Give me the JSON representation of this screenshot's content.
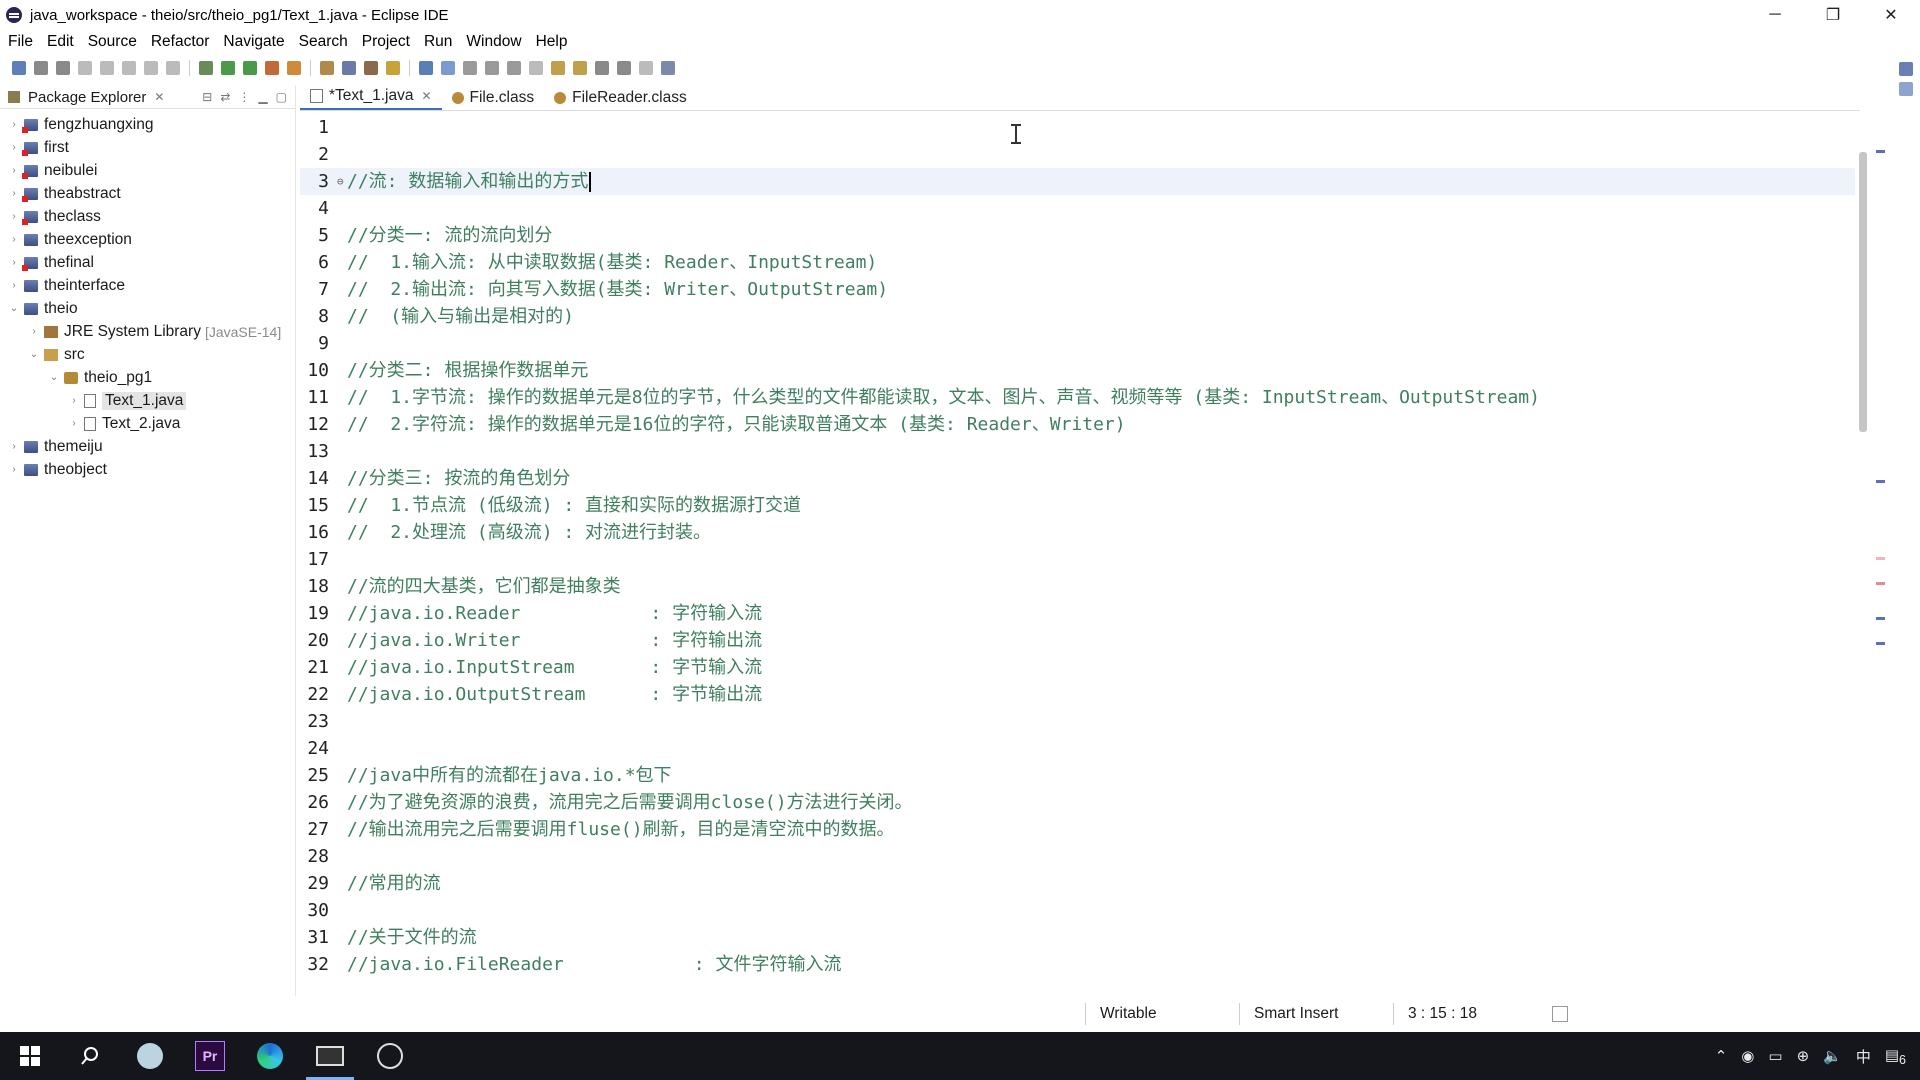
{
  "window": {
    "title": "java_workspace - theio/src/theio_pg1/Text_1.java - Eclipse IDE",
    "min": "─",
    "max": "❐",
    "close": "✕"
  },
  "menu": [
    "File",
    "Edit",
    "Source",
    "Refactor",
    "Navigate",
    "Search",
    "Project",
    "Run",
    "Window",
    "Help"
  ],
  "explorer": {
    "title": "Package Explorer",
    "close": "✕",
    "items": [
      {
        "label": "fengzhuangxing",
        "type": "project",
        "arrow": "›",
        "indent": 0
      },
      {
        "label": "first",
        "type": "project",
        "arrow": "›",
        "indent": 0
      },
      {
        "label": "neibulei",
        "type": "project",
        "arrow": "›",
        "indent": 0
      },
      {
        "label": "theabstract",
        "type": "project",
        "arrow": "›",
        "indent": 0
      },
      {
        "label": "theclass",
        "type": "project",
        "arrow": "›",
        "indent": 0
      },
      {
        "label": "theexception",
        "type": "project",
        "arrow": "›",
        "indent": 0
      },
      {
        "label": "thefinal",
        "type": "project",
        "arrow": "›",
        "indent": 0
      },
      {
        "label": "theinterface",
        "type": "project",
        "arrow": "›",
        "indent": 0
      },
      {
        "label": "theio",
        "type": "project",
        "arrow": "⌄",
        "indent": 0
      },
      {
        "label": "JRE System Library",
        "badge": "[JavaSE-14]",
        "type": "lib",
        "arrow": "›",
        "indent": 1
      },
      {
        "label": "src",
        "type": "src",
        "arrow": "⌄",
        "indent": 1
      },
      {
        "label": "theio_pg1",
        "type": "pkg",
        "arrow": "⌄",
        "indent": 2
      },
      {
        "label": "Text_1.java",
        "type": "java",
        "arrow": "›",
        "indent": 3,
        "selected": true
      },
      {
        "label": "Text_2.java",
        "type": "java",
        "arrow": "›",
        "indent": 3
      },
      {
        "label": "themeiju",
        "type": "project",
        "arrow": "›",
        "indent": 0
      },
      {
        "label": "theobject",
        "type": "project",
        "arrow": "›",
        "indent": 0
      }
    ]
  },
  "editor": {
    "tabs": [
      {
        "label": "*Text_1.java",
        "active": true,
        "closable": true,
        "kind": "java"
      },
      {
        "label": "File.class",
        "active": false,
        "closable": false,
        "kind": "class"
      },
      {
        "label": "FileReader.class",
        "active": false,
        "closable": false,
        "kind": "class"
      }
    ],
    "current_line": 3,
    "lines": [
      {
        "n": "1",
        "text": ""
      },
      {
        "n": "2",
        "text": ""
      },
      {
        "n": "3",
        "text": "//流: 数据输入和输出的方式",
        "fold": "⊖"
      },
      {
        "n": "4",
        "text": ""
      },
      {
        "n": "5",
        "text": "//分类一: 流的流向划分"
      },
      {
        "n": "6",
        "text": "//  1.输入流: 从中读取数据(基类: Reader、InputStream)"
      },
      {
        "n": "7",
        "text": "//  2.输出流: 向其写入数据(基类: Writer、OutputStream)"
      },
      {
        "n": "8",
        "text": "//  (输入与输出是相对的)"
      },
      {
        "n": "9",
        "text": ""
      },
      {
        "n": "10",
        "text": "//分类二: 根据操作数据单元"
      },
      {
        "n": "11",
        "text": "//  1.字节流: 操作的数据单元是8位的字节，什么类型的文件都能读取，文本、图片、声音、视频等等 (基类: InputStream、OutputStream)"
      },
      {
        "n": "12",
        "text": "//  2.字符流: 操作的数据单元是16位的字符，只能读取普通文本 (基类: Reader、Writer)"
      },
      {
        "n": "13",
        "text": ""
      },
      {
        "n": "14",
        "text": "//分类三: 按流的角色划分"
      },
      {
        "n": "15",
        "text": "//  1.节点流 (低级流) : 直接和实际的数据源打交道"
      },
      {
        "n": "16",
        "text": "//  2.处理流 (高级流) : 对流进行封装。"
      },
      {
        "n": "17",
        "text": ""
      },
      {
        "n": "18",
        "text": "//流的四大基类，它们都是抽象类"
      },
      {
        "n": "19",
        "text": "//java.io.Reader            : 字符输入流"
      },
      {
        "n": "20",
        "text": "//java.io.Writer            : 字符输出流"
      },
      {
        "n": "21",
        "text": "//java.io.InputStream       : 字节输入流"
      },
      {
        "n": "22",
        "text": "//java.io.OutputStream      : 字节输出流"
      },
      {
        "n": "23",
        "text": ""
      },
      {
        "n": "24",
        "text": ""
      },
      {
        "n": "25",
        "text": "//java中所有的流都在java.io.*包下"
      },
      {
        "n": "26",
        "text": "//为了避免资源的浪费，流用完之后需要调用close()方法进行关闭。"
      },
      {
        "n": "27",
        "text": "//输出流用完之后需要调用fluse()刷新，目的是清空流中的数据。"
      },
      {
        "n": "28",
        "text": ""
      },
      {
        "n": "29",
        "text": "//常用的流"
      },
      {
        "n": "30",
        "text": ""
      },
      {
        "n": "31",
        "text": "//关于文件的流"
      },
      {
        "n": "32",
        "text": "//java.io.FileReader            : 文件字符输入流"
      }
    ]
  },
  "status": {
    "writable": "Writable",
    "insert_mode": "Smart Insert",
    "position": "3 : 15 : 18"
  },
  "taskbar": {
    "premiere_label": "Pr",
    "ime": "中",
    "notif_count": "6"
  },
  "colors": {
    "comment": "#3f7f5f",
    "current_line_bg": "#eef3fb",
    "taskbar_bg": "#14161b",
    "accent": "#3d6fb5"
  }
}
